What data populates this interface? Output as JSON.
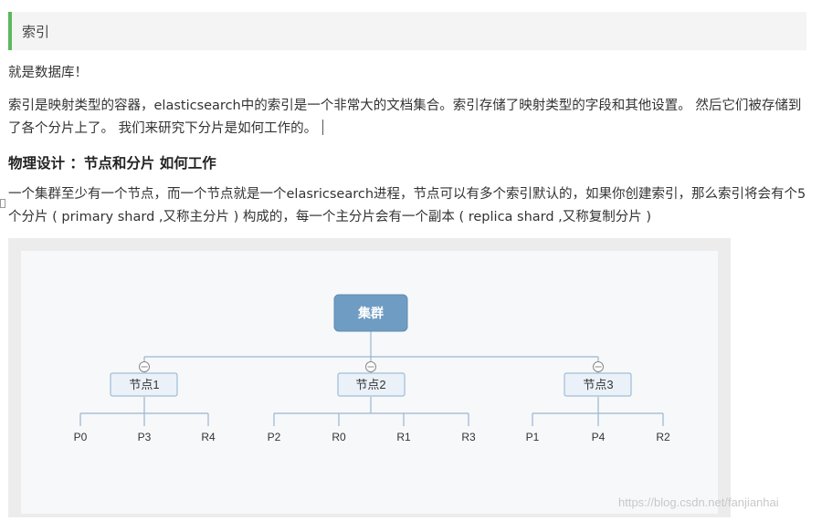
{
  "section": {
    "title": "索引"
  },
  "paragraphs": {
    "p1": "就是数据库！",
    "p2": "索引是映射类型的容器，elasticsearch中的索引是一个非常大的文档集合。索引存储了映射类型的字段和其他设置。 然后它们被存储到了各个分片上了。 我们来研究下分片是如何工作的。",
    "h2": "物理设计 ：节点和分片 如何工作",
    "p3": "一个集群至少有一个节点，而一个节点就是一个elasricsearch进程，节点可以有多个索引默认的，如果你创建索引，那么索引将会有个5个分片 ( primary shard ,又称主分片 ) 构成的，每一个主分片会有一个副本 ( replica shard ,又称复制分片 )"
  },
  "diagram": {
    "cluster_label": "集群",
    "nodes": [
      {
        "label": "节点1",
        "shards": [
          "P0",
          "P3",
          "R4"
        ]
      },
      {
        "label": "节点2",
        "shards": [
          "P2",
          "R0",
          "R1",
          "R3"
        ]
      },
      {
        "label": "节点3",
        "shards": [
          "P1",
          "P4",
          "R2"
        ]
      }
    ],
    "colors": {
      "cluster_fill": "#6f9cc2",
      "node_fill": "#eaf1f8",
      "node_stroke": "#8fb1cf",
      "line": "#9ab6d0"
    }
  },
  "watermark": "https://blog.csdn.net/fanjianhai"
}
